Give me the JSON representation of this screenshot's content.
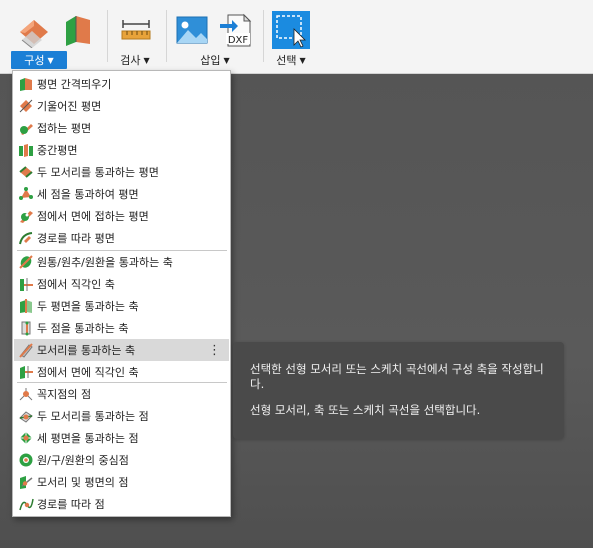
{
  "toolbar": {
    "groups": [
      {
        "label": "구성",
        "icons": [
          "offset-plane-icon",
          "plane-at-angle-icon"
        ]
      },
      {
        "label": "검사",
        "icons": [
          "measure-icon"
        ]
      },
      {
        "label": "삽입",
        "icons": [
          "insert-image-icon",
          "insert-dxf-icon"
        ]
      },
      {
        "label": "선택",
        "icons": [
          "select-window-icon"
        ]
      }
    ],
    "dxf_text": "DXF"
  },
  "menu": {
    "planes": [
      {
        "label": "평면 간격띄우기",
        "icon": "offset-plane-icon"
      },
      {
        "label": "기울어진 평면",
        "icon": "plane-at-angle-icon"
      },
      {
        "label": "접하는 평면",
        "icon": "tangent-plane-icon"
      },
      {
        "label": "중간평면",
        "icon": "midplane-icon"
      },
      {
        "label": "두 모서리를 통과하는 평면",
        "icon": "plane-two-edges-icon"
      },
      {
        "label": "세 점을 통과하여 평면",
        "icon": "plane-three-points-icon"
      },
      {
        "label": "점에서 면에 접하는 평면",
        "icon": "plane-tangent-at-point-icon"
      },
      {
        "label": "경로를 따라 평면",
        "icon": "plane-along-path-icon"
      }
    ],
    "axes": [
      {
        "label": "원통/원추/원환을 통과하는 축",
        "icon": "axis-through-cylinder-icon"
      },
      {
        "label": "점에서 직각인 축",
        "icon": "axis-perpendicular-at-point-icon"
      },
      {
        "label": "두 평면을 통과하는 축",
        "icon": "axis-two-planes-icon"
      },
      {
        "label": "두 점을 통과하는 축",
        "icon": "axis-two-points-icon"
      },
      {
        "label": "모서리를 통과하는 축",
        "icon": "axis-through-edge-icon",
        "more": "⋮"
      },
      {
        "label": "점에서 면에 직각인 축",
        "icon": "axis-perpendicular-to-face-icon"
      }
    ],
    "points": [
      {
        "label": "꼭지점의 점",
        "icon": "point-at-vertex-icon"
      },
      {
        "label": "두 모서리를 통과하는 점",
        "icon": "point-two-edges-icon"
      },
      {
        "label": "세 평면을 통과하는 점",
        "icon": "point-three-planes-icon"
      },
      {
        "label": "원/구/원환의 중심점",
        "icon": "point-center-icon"
      },
      {
        "label": "모서리 및 평면의 점",
        "icon": "point-edge-and-plane-icon"
      },
      {
        "label": "경로를 따라 점",
        "icon": "point-along-path-icon"
      }
    ]
  },
  "tooltip": {
    "line1": "선택한 선형 모서리 또는 스케치 곡선에서 구성 축을 작성합니다.",
    "line2": "선형 모서리, 축 또는 스케치 곡선을 선택합니다."
  },
  "colors": {
    "accent": "#1b7fd6",
    "menu_hover": "#d9d9d9"
  }
}
